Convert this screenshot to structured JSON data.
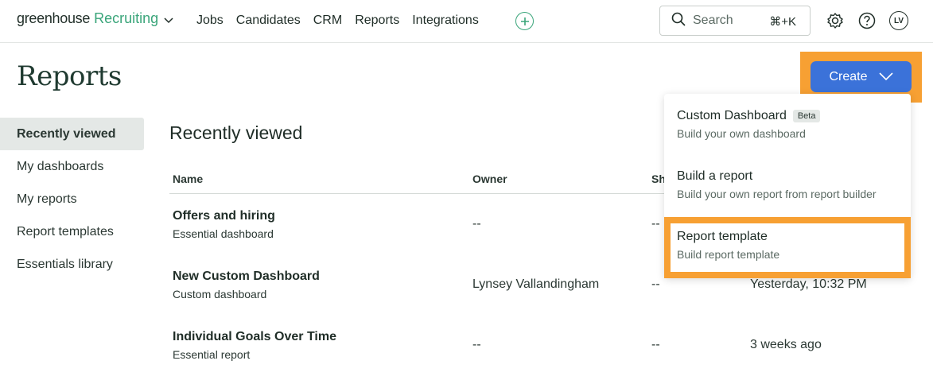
{
  "brand": {
    "name": "greenhouse",
    "product": "Recruiting"
  },
  "nav": {
    "items": [
      "Jobs",
      "Candidates",
      "CRM",
      "Reports",
      "Integrations"
    ]
  },
  "search": {
    "placeholder": "Search",
    "shortcut": "⌘+K"
  },
  "user": {
    "initials": "LV"
  },
  "page": {
    "title": "Reports"
  },
  "sidebar": {
    "items": [
      {
        "label": "Recently viewed",
        "active": true
      },
      {
        "label": "My dashboards"
      },
      {
        "label": "My reports"
      },
      {
        "label": "Report templates"
      },
      {
        "label": "Essentials library"
      }
    ]
  },
  "main": {
    "section_title": "Recently viewed",
    "columns": {
      "name": "Name",
      "owner": "Owner",
      "shared": "Sh"
    },
    "rows": [
      {
        "name": "Offers and hiring",
        "type": "Essential dashboard",
        "owner": "--",
        "shared": "--",
        "viewed": ""
      },
      {
        "name": "New Custom Dashboard",
        "type": "Custom dashboard",
        "owner": "Lynsey Vallandingham",
        "shared": "--",
        "viewed": "Yesterday, 10:32 PM"
      },
      {
        "name": "Individual Goals Over Time",
        "type": "Essential report",
        "owner": "--",
        "shared": "--",
        "viewed": "3 weeks ago"
      }
    ]
  },
  "create": {
    "label": "Create",
    "menu": [
      {
        "title": "Custom Dashboard",
        "badge": "Beta",
        "desc": "Build your own dashboard"
      },
      {
        "title": "Build a report",
        "desc": "Build your own report from report builder"
      },
      {
        "title": "Report template",
        "desc": "Build report template"
      }
    ]
  },
  "colors": {
    "brand_green": "#3aa57a",
    "create_blue": "#3b72d9",
    "highlight_orange": "#f7a033"
  }
}
